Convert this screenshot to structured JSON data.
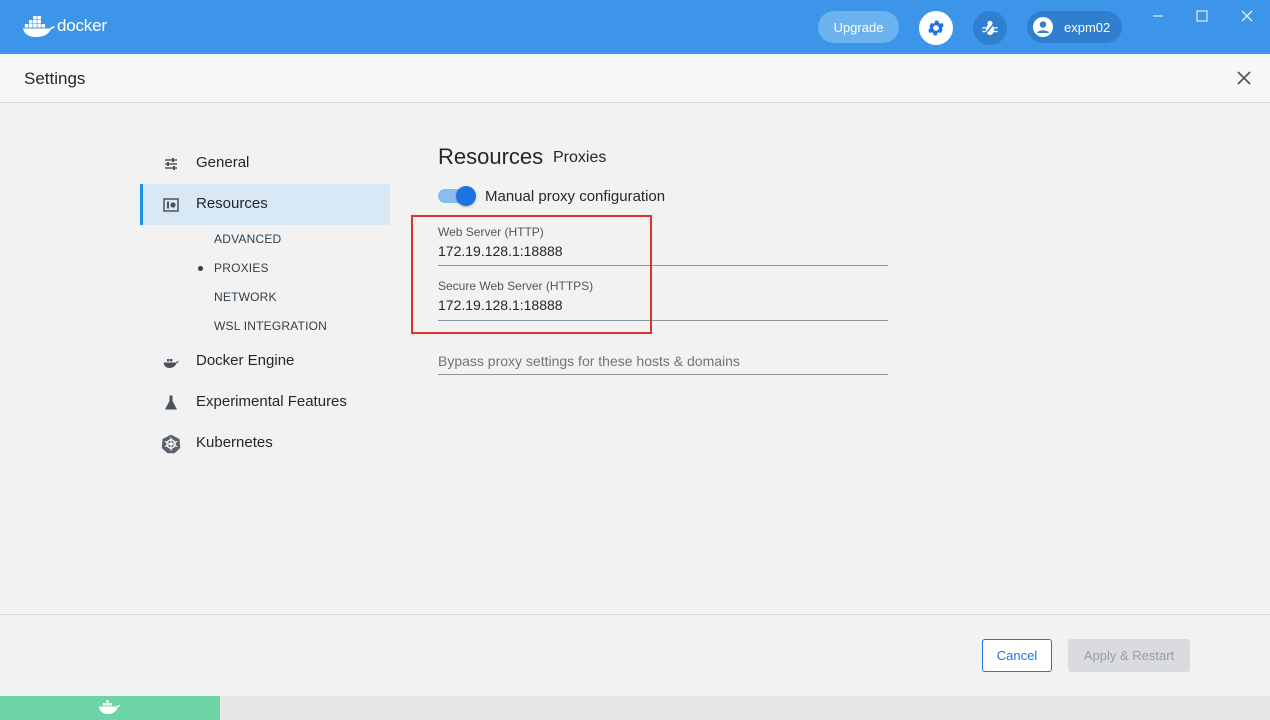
{
  "app": {
    "brand": "docker",
    "upgrade_label": "Upgrade",
    "account_name": "expm02"
  },
  "settings": {
    "title": "Settings"
  },
  "sidebar": {
    "items": [
      {
        "label": "General",
        "icon": "sliders-icon"
      },
      {
        "label": "Resources",
        "icon": "resources-icon",
        "active": true
      },
      {
        "label": "Docker Engine",
        "icon": "whale-engine-icon"
      },
      {
        "label": "Experimental Features",
        "icon": "flask-icon"
      },
      {
        "label": "Kubernetes",
        "icon": "kubernetes-helm-icon"
      }
    ],
    "resources_subitems": [
      "ADVANCED",
      "PROXIES",
      "NETWORK",
      "WSL INTEGRATION"
    ],
    "selected_subitem": "PROXIES"
  },
  "main": {
    "title": "Resources",
    "subtitle": "Proxies",
    "manual_proxy": {
      "label": "Manual proxy configuration",
      "enabled": true
    },
    "http": {
      "label": "Web Server (HTTP)",
      "value": "172.19.128.1:18888"
    },
    "https": {
      "label": "Secure Web Server (HTTPS)",
      "value": "172.19.128.1:18888"
    },
    "bypass": {
      "placeholder": "Bypass proxy settings for these hosts & domains",
      "value": ""
    }
  },
  "footer": {
    "cancel_label": "Cancel",
    "apply_label": "Apply & Restart"
  },
  "colors": {
    "titlebar": "#3c95e8",
    "accent": "#1d74e0",
    "active_nav_bg": "#d8e8f4",
    "highlight_box": "#e0302f",
    "engine_status": "#6dd4a8"
  }
}
